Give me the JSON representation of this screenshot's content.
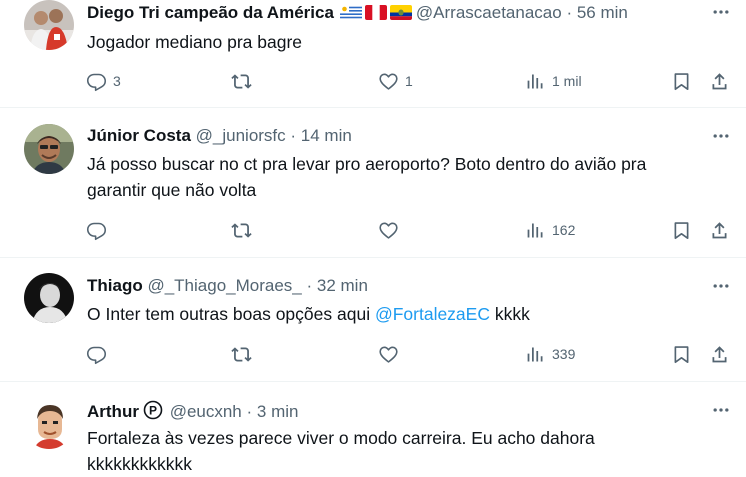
{
  "replies": [
    {
      "name": "Diego Tri campeão da América",
      "handle": "@Arrascaetanacao",
      "time": "56 min",
      "flags": [
        "uruguay",
        "peru",
        "ecuador"
      ],
      "text": "Jogador mediano pra bagre",
      "reply_count": "3",
      "retweet_count": "",
      "like_count": "1",
      "view_count": "1 mil"
    },
    {
      "name": "Júnior Costa",
      "handle": "@_juniorsfc",
      "time": "14 min",
      "text_line1": "Já posso buscar no ct pra levar pro aeroporto? Boto dentro do avião pra",
      "text_line2": "garantir que não volta",
      "reply_count": "",
      "retweet_count": "",
      "like_count": "",
      "view_count": "162"
    },
    {
      "name": "Thiago",
      "handle": "@_Thiago_Moraes_",
      "time": "32 min",
      "text_before": "O Inter tem outras boas opções aqui ",
      "mention": "@FortalezaEC",
      "text_after": " kkkk",
      "reply_count": "",
      "retweet_count": "",
      "like_count": "",
      "view_count": "339"
    },
    {
      "name": "Arthur",
      "verified_badge": "P",
      "handle": "@eucxnh",
      "time": "3 min",
      "text_line1": "Fortaleza às vezes parece viver o modo carreira. Eu acho dahora",
      "text_line2": "kkkkkkkkkkkk"
    }
  ],
  "separator": "·",
  "colors": {
    "text": "#0f1419",
    "secondary": "#536471",
    "link": "#1d9bf0",
    "divider": "#eff3f4"
  },
  "icons": [
    "more-icon",
    "reply-icon",
    "retweet-icon",
    "like-icon",
    "views-icon",
    "bookmark-icon",
    "share-icon"
  ]
}
